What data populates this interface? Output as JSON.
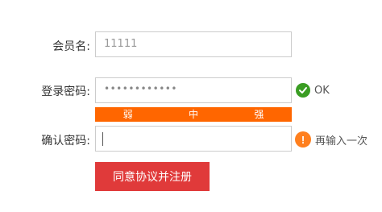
{
  "form": {
    "member": {
      "label": "会员名:",
      "placeholder": "11111"
    },
    "password": {
      "label": "登录密码:",
      "value": "••••••••••••",
      "status_text": "OK",
      "status_icon": "check-circle-icon"
    },
    "strength": {
      "weak": "弱",
      "medium": "中",
      "strong": "强",
      "color": "#ff6600"
    },
    "confirm": {
      "label": "确认密码:",
      "value": "",
      "status_text": "再输入一次",
      "status_icon": "warning-circle-icon"
    },
    "submit_label": "同意协议并注册"
  },
  "colors": {
    "accent": "#e03a3a",
    "ok": "#3a9d23",
    "warn": "#ff7f1e"
  }
}
